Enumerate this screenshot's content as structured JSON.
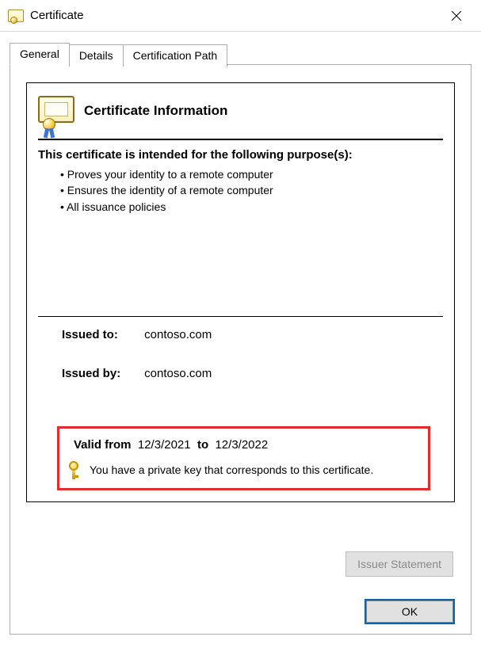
{
  "window": {
    "title": "Certificate"
  },
  "tabs": {
    "general": "General",
    "details": "Details",
    "certpath": "Certification Path"
  },
  "card": {
    "heading": "Certificate Information",
    "purpose_heading": "This certificate is intended for the following purpose(s):",
    "purposes": [
      "Proves your identity to a remote computer",
      "Ensures the identity of a remote computer",
      "All issuance policies"
    ],
    "issued_to_label": "Issued to:",
    "issued_to_value": "contoso.com",
    "issued_by_label": "Issued by:",
    "issued_by_value": "contoso.com",
    "valid_from_label": "Valid from",
    "valid_from_value": "12/3/2021",
    "valid_to_label": "to",
    "valid_to_value": "12/3/2022",
    "private_key_msg": "You have a private key that corresponds to this certificate."
  },
  "buttons": {
    "issuer_statement": "Issuer Statement",
    "ok": "OK"
  }
}
